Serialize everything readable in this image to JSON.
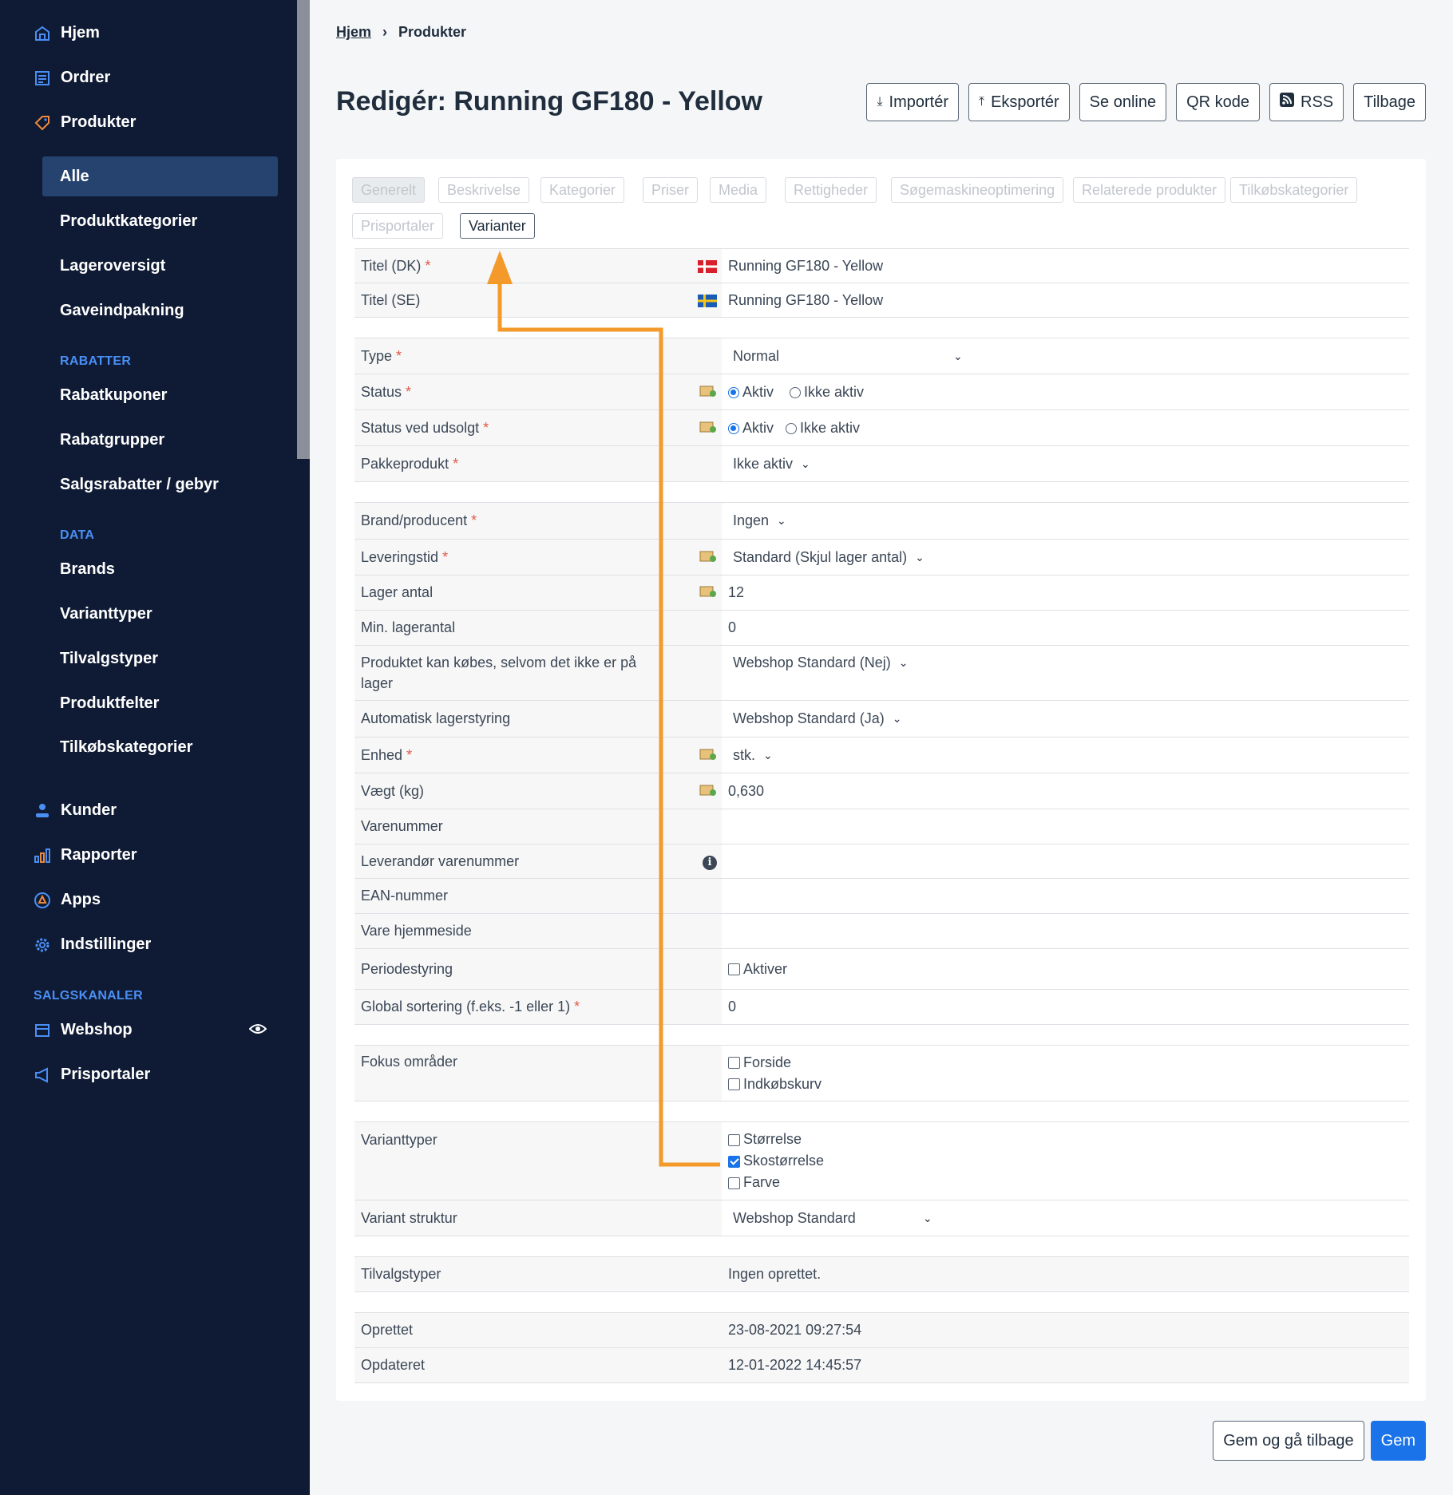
{
  "sidebar": {
    "main_items": [
      {
        "label": "Hjem",
        "icon": "home-icon"
      },
      {
        "label": "Ordrer",
        "icon": "orders-icon"
      },
      {
        "label": "Produkter",
        "icon": "tag-icon"
      }
    ],
    "produkter_sub": [
      "Alle",
      "Produktkategorier",
      "Lageroversigt",
      "Gaveindpakning"
    ],
    "rabatter_head": "RABATTER",
    "rabatter_items": [
      "Rabatkuponer",
      "Rabatgrupper",
      "Salgsrabatter / gebyr"
    ],
    "data_head": "DATA",
    "data_items": [
      "Brands",
      "Varianttyper",
      "Tilvalgstyper",
      "Produktfelter",
      "Tilkøbskategorier"
    ],
    "lower_items": [
      {
        "label": "Kunder",
        "icon": "user-icon"
      },
      {
        "label": "Rapporter",
        "icon": "bar-chart-icon"
      },
      {
        "label": "Apps",
        "icon": "apps-icon"
      },
      {
        "label": "Indstillinger",
        "icon": "gear-icon"
      }
    ],
    "salgskanaler_head": "SALGSKANALER",
    "channels": [
      {
        "label": "Webshop",
        "icon": "store-icon"
      },
      {
        "label": "Prisportaler",
        "icon": "megaphone-icon"
      }
    ]
  },
  "breadcrumb": {
    "home": "Hjem",
    "current": "Produkter"
  },
  "page_title": "Redigér: Running GF180 - Yellow",
  "toolbar": {
    "import": "Importér",
    "export": "Eksportér",
    "online": "Se online",
    "qr": "QR kode",
    "rss": "RSS",
    "back": "Tilbage"
  },
  "tabs": [
    "Generelt",
    "Beskrivelse",
    "Kategorier",
    "Priser",
    "Media",
    "Rettigheder",
    "Søgemaskineoptimering",
    "Relaterede produkter",
    "Tilkøbskategorier",
    "Prisportaler",
    "Varianter"
  ],
  "form": {
    "title_dk_label": "Titel (DK)",
    "title_dk_value": "Running GF180 - Yellow",
    "title_se_label": "Titel (SE)",
    "title_se_value": "Running GF180 - Yellow",
    "type_label": "Type",
    "type_value": "Normal",
    "status_label": "Status",
    "status_sold_label": "Status ved udsolgt",
    "radio_active": "Aktiv",
    "radio_inactive": "Ikke aktiv",
    "package_label": "Pakkeprodukt",
    "package_value": "Ikke aktiv",
    "brand_label": "Brand/producent",
    "brand_value": "Ingen",
    "delivery_label": "Leveringstid",
    "delivery_value": "Standard (Skjul lager antal)",
    "stock_label": "Lager antal",
    "stock_value": "12",
    "min_stock_label": "Min. lagerantal",
    "min_stock_value": "0",
    "buy_oos_label": "Produktet kan købes, selvom det ikke er på lager",
    "buy_oos_value": "Webshop Standard (Nej)",
    "auto_stock_label": "Automatisk lagerstyring",
    "auto_stock_value": "Webshop Standard (Ja)",
    "unit_label": "Enhed",
    "unit_value": "stk.",
    "weight_label": "Vægt (kg)",
    "weight_value": "0,630",
    "sku_label": "Varenummer",
    "supplier_sku_label": "Leverandør varenummer",
    "ean_label": "EAN-nummer",
    "homepage_label": "Vare hjemmeside",
    "period_label": "Periodestyring",
    "period_value": "Aktiver",
    "sort_label": "Global sortering (f.eks. -1 eller 1)",
    "sort_value": "0",
    "focus_label": "Fokus områder",
    "focus_opts": [
      "Forside",
      "Indkøbskurv"
    ],
    "variant_types_label": "Varianttyper",
    "variant_opts": [
      "Størrelse",
      "Skostørrelse",
      "Farve"
    ],
    "variant_checked": "Skostørrelse",
    "variant_struct_label": "Variant struktur",
    "variant_struct_value": "Webshop Standard",
    "addons_label": "Tilvalgstyper",
    "addons_value": "Ingen oprettet.",
    "created_label": "Oprettet",
    "created_value": "23-08-2021 09:27:54",
    "updated_label": "Opdateret",
    "updated_value": "12-01-2022 14:45:57"
  },
  "actions": {
    "save_back": "Gem og gå tilbage",
    "save": "Gem"
  },
  "colors": {
    "sidebar_bg": "#0f1b34",
    "accent": "#4a8ff5",
    "primary": "#1a73e8",
    "annotation_arrow": "#f39a2b"
  }
}
